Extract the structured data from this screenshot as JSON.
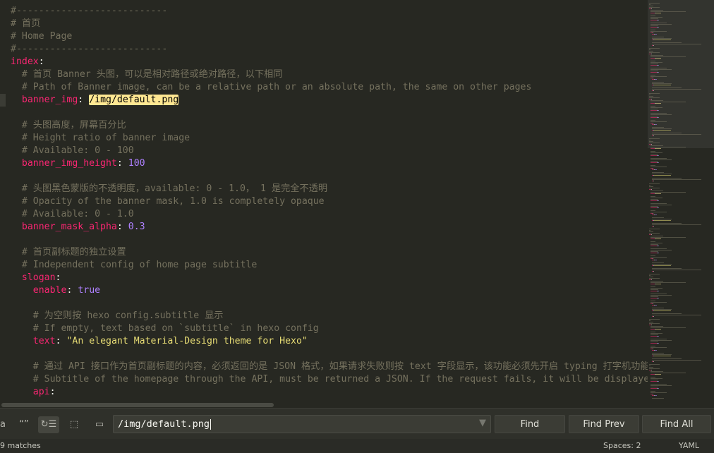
{
  "editor": {
    "lines": [
      {
        "indent": 0,
        "tokens": [
          {
            "t": "c",
            "v": "#---------------------------"
          }
        ]
      },
      {
        "indent": 0,
        "tokens": [
          {
            "t": "c",
            "v": "# 首页"
          }
        ]
      },
      {
        "indent": 0,
        "tokens": [
          {
            "t": "c",
            "v": "# Home Page"
          }
        ]
      },
      {
        "indent": 0,
        "tokens": [
          {
            "t": "c",
            "v": "#---------------------------"
          }
        ]
      },
      {
        "indent": 0,
        "tokens": [
          {
            "t": "k",
            "v": "index"
          },
          {
            "t": "p",
            "v": ":"
          }
        ]
      },
      {
        "indent": 2,
        "tokens": [
          {
            "t": "c",
            "v": "# 首页 Banner 头图，可以是相对路径或绝对路径，以下相同"
          }
        ]
      },
      {
        "indent": 2,
        "tokens": [
          {
            "t": "c",
            "v": "# Path of Banner image, can be a relative path or an absolute path, the same on other pages"
          }
        ]
      },
      {
        "indent": 2,
        "tokens": [
          {
            "t": "k",
            "v": "banner_img"
          },
          {
            "t": "p",
            "v": ": "
          },
          {
            "t": "hl",
            "v": "/img/default.png"
          }
        ]
      },
      {
        "indent": 0,
        "tokens": []
      },
      {
        "indent": 2,
        "tokens": [
          {
            "t": "c",
            "v": "# 头图高度，屏幕百分比"
          }
        ]
      },
      {
        "indent": 2,
        "tokens": [
          {
            "t": "c",
            "v": "# Height ratio of banner image"
          }
        ]
      },
      {
        "indent": 2,
        "tokens": [
          {
            "t": "c",
            "v": "# Available: 0 - 100"
          }
        ]
      },
      {
        "indent": 2,
        "tokens": [
          {
            "t": "k",
            "v": "banner_img_height"
          },
          {
            "t": "p",
            "v": ": "
          },
          {
            "t": "n",
            "v": "100"
          }
        ]
      },
      {
        "indent": 0,
        "tokens": []
      },
      {
        "indent": 2,
        "tokens": [
          {
            "t": "c",
            "v": "# 头图黑色蒙版的不透明度，available: 0 - 1.0， 1 是完全不透明"
          }
        ]
      },
      {
        "indent": 2,
        "tokens": [
          {
            "t": "c",
            "v": "# Opacity of the banner mask, 1.0 is completely opaque"
          }
        ]
      },
      {
        "indent": 2,
        "tokens": [
          {
            "t": "c",
            "v": "# Available: 0 - 1.0"
          }
        ]
      },
      {
        "indent": 2,
        "tokens": [
          {
            "t": "k",
            "v": "banner_mask_alpha"
          },
          {
            "t": "p",
            "v": ": "
          },
          {
            "t": "n",
            "v": "0.3"
          }
        ]
      },
      {
        "indent": 0,
        "tokens": []
      },
      {
        "indent": 2,
        "tokens": [
          {
            "t": "c",
            "v": "# 首页副标题的独立设置"
          }
        ]
      },
      {
        "indent": 2,
        "tokens": [
          {
            "t": "c",
            "v": "# Independent config of home page subtitle"
          }
        ]
      },
      {
        "indent": 2,
        "tokens": [
          {
            "t": "k",
            "v": "slogan"
          },
          {
            "t": "p",
            "v": ":"
          }
        ]
      },
      {
        "indent": 4,
        "tokens": [
          {
            "t": "k",
            "v": "enable"
          },
          {
            "t": "p",
            "v": ": "
          },
          {
            "t": "n",
            "v": "true"
          }
        ]
      },
      {
        "indent": 0,
        "tokens": []
      },
      {
        "indent": 4,
        "tokens": [
          {
            "t": "c",
            "v": "# 为空则按 hexo config.subtitle 显示"
          }
        ]
      },
      {
        "indent": 4,
        "tokens": [
          {
            "t": "c",
            "v": "# If empty, text based on `subtitle` in hexo config"
          }
        ]
      },
      {
        "indent": 4,
        "tokens": [
          {
            "t": "k",
            "v": "text"
          },
          {
            "t": "p",
            "v": ": "
          },
          {
            "t": "s",
            "v": "\"An elegant Material-Design theme for Hexo\""
          }
        ]
      },
      {
        "indent": 0,
        "tokens": []
      },
      {
        "indent": 4,
        "tokens": [
          {
            "t": "c",
            "v": "# 通过 API 接口作为首页副标题的内容，必须返回的是 JSON 格式，如果请求失败则按 text 字段显示，该功能必须先开启 typing 打字机功能"
          }
        ]
      },
      {
        "indent": 4,
        "tokens": [
          {
            "t": "c",
            "v": "# Subtitle of the homepage through the API, must be returned a JSON. If the request fails, it will be displayed in `text` value"
          }
        ]
      },
      {
        "indent": 4,
        "tokens": [
          {
            "t": "k",
            "v": "api"
          },
          {
            "t": "p",
            "v": ":"
          }
        ]
      }
    ]
  },
  "find_bar": {
    "options": [
      {
        "name": "whole-word-toggle",
        "icon": "a",
        "active": false
      },
      {
        "name": "quote-toggle",
        "icon": "“”",
        "active": false
      },
      {
        "name": "wrap-toggle",
        "icon": "↻☰",
        "active": true
      },
      {
        "name": "in-selection-toggle",
        "icon": "⬚",
        "active": false
      },
      {
        "name": "highlight-matches-toggle",
        "icon": "▭",
        "active": false
      }
    ],
    "query": "/img/default.png",
    "history_icon": "▼",
    "find_label": "Find",
    "find_prev_label": "Find Prev",
    "find_all_label": "Find All"
  },
  "status": {
    "matches": "9 matches",
    "spaces": "Spaces: 2",
    "syntax": "YAML"
  },
  "colors": {
    "background": "#272822",
    "comment": "#75715e",
    "key": "#f92672",
    "string": "#e6db74",
    "number": "#ae81ff",
    "highlight": "#ffe792"
  }
}
